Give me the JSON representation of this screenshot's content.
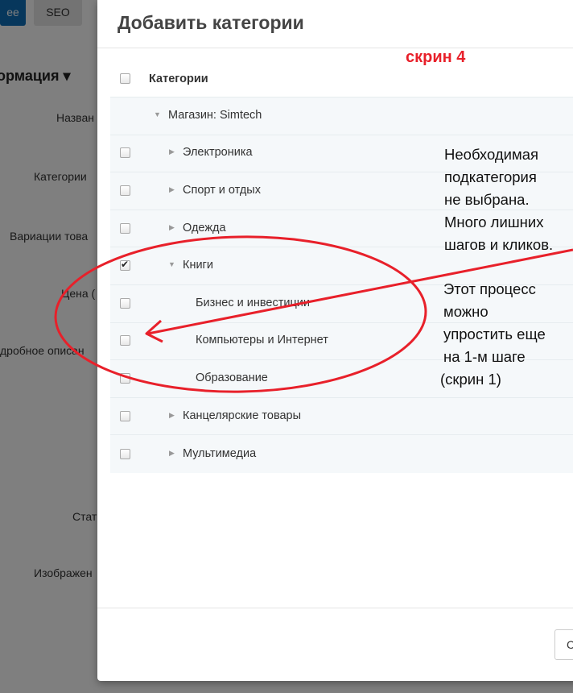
{
  "background": {
    "tabs": [
      {
        "label": "ee"
      },
      {
        "label": "SEO"
      }
    ],
    "section_title": "ормация ▾",
    "labels": [
      "Назван",
      "Категории",
      "Вариации това",
      "Цена (",
      "дробное описан",
      "Стат",
      "Изображен"
    ]
  },
  "modal": {
    "title": "Добавить категории",
    "header": "Категории",
    "root": "Магазин: Simtech",
    "categories": [
      {
        "label": "Электроника",
        "checked": false,
        "expandable": true
      },
      {
        "label": "Спорт и отдых",
        "checked": false,
        "expandable": true
      },
      {
        "label": "Одежда",
        "checked": false,
        "expandable": true
      },
      {
        "label": "Книги",
        "checked": true,
        "expanded": true
      },
      {
        "label": "Бизнес и инвестиции",
        "checked": false,
        "child": true
      },
      {
        "label": "Компьютеры и Интернет",
        "checked": false,
        "child": true
      },
      {
        "label": "Образование",
        "checked": false,
        "child": true
      },
      {
        "label": "Канцелярские товары",
        "checked": false,
        "expandable": true
      },
      {
        "label": "Мультимедиа",
        "checked": false,
        "expandable": true
      }
    ],
    "footer_button": "С"
  },
  "annotations": {
    "screen_label": "скрин 4",
    "note1": [
      "Необходимая",
      "подкатегория",
      "не выбрана.",
      "Много лишних",
      "шагов и кликов."
    ],
    "note2": [
      "Этот процесс",
      "можно",
      "упростить еще",
      "на 1-м шаге",
      "(скрин 1)"
    ],
    "color": "#e8202a"
  }
}
